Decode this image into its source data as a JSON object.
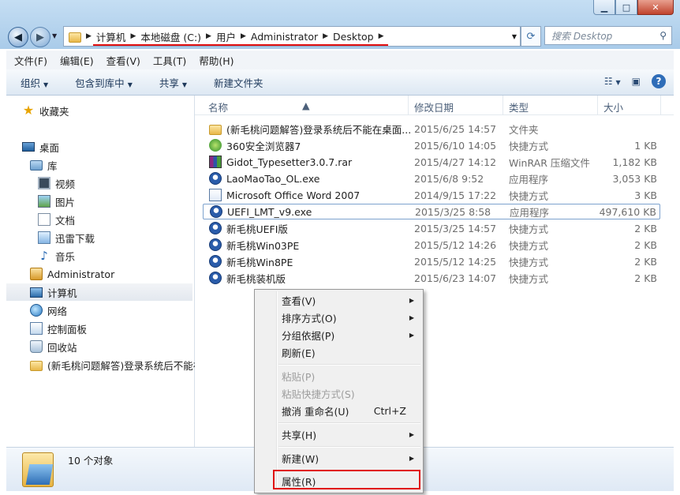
{
  "window": {
    "min_glyph": "▁",
    "max_glyph": "□",
    "close_glyph": "✕"
  },
  "address": {
    "segments": [
      "计算机",
      "本地磁盘 (C:)",
      "用户",
      "Administrator",
      "Desktop"
    ]
  },
  "search": {
    "placeholder": "搜索 Desktop"
  },
  "menu": [
    "文件(F)",
    "编辑(E)",
    "查看(V)",
    "工具(T)",
    "帮助(H)"
  ],
  "toolbar": {
    "organize": "组织",
    "include_library": "包含到库中",
    "share": "共享",
    "new_folder": "新建文件夹"
  },
  "sidebar": {
    "favorites": "收藏夹",
    "desktop": "桌面",
    "library": "库",
    "video": "视频",
    "pictures": "图片",
    "documents": "文档",
    "xunlei": "迅雷下载",
    "music": "音乐",
    "administrator": "Administrator",
    "computer": "计算机",
    "network": "网络",
    "control_panel": "控制面板",
    "recycle_bin": "回收站",
    "folder": "(新毛桃问题解答)登录系统后不能在"
  },
  "columns": {
    "name": "名称",
    "modified": "修改日期",
    "type": "类型",
    "size": "大小"
  },
  "files": [
    {
      "name": "(新毛桃问题解答)登录系统后不能在桌面...",
      "date": "2015/6/25 14:57",
      "type": "文件夹",
      "size": "",
      "icon": "folder-icon"
    },
    {
      "name": "360安全浏览器7",
      "date": "2015/6/10 14:05",
      "type": "快捷方式",
      "size": "1 KB",
      "icon": "browser-shortcut-icon"
    },
    {
      "name": "Gidot_Typesetter3.0.7.rar",
      "date": "2015/4/27 14:12",
      "type": "WinRAR 压缩文件",
      "size": "1,182 KB",
      "icon": "winrar-icon"
    },
    {
      "name": "LaoMaoTao_OL.exe",
      "date": "2015/6/8 9:52",
      "type": "应用程序",
      "size": "3,053 KB",
      "icon": "laomaotao-icon"
    },
    {
      "name": "Microsoft Office Word 2007",
      "date": "2014/9/15 17:22",
      "type": "快捷方式",
      "size": "3 KB",
      "icon": "word-shortcut-icon"
    },
    {
      "name": "UEFI_LMT_v9.exe",
      "date": "2015/3/25 8:58",
      "type": "应用程序",
      "size": "497,610 KB",
      "icon": "laomaotao-icon"
    },
    {
      "name": "新毛桃UEFI版",
      "date": "2015/3/25 14:57",
      "type": "快捷方式",
      "size": "2 KB",
      "icon": "laomaotao-icon"
    },
    {
      "name": "新毛桃Win03PE",
      "date": "2015/5/12 14:26",
      "type": "快捷方式",
      "size": "2 KB",
      "icon": "laomaotao-icon"
    },
    {
      "name": "新毛桃Win8PE",
      "date": "2015/5/12 14:25",
      "type": "快捷方式",
      "size": "2 KB",
      "icon": "laomaotao-icon"
    },
    {
      "name": "新毛桃装机版",
      "date": "2015/6/23 14:07",
      "type": "快捷方式",
      "size": "2 KB",
      "icon": "laomaotao-icon"
    }
  ],
  "status": {
    "count": "10 个对象"
  },
  "context_menu": {
    "view": "查看(V)",
    "sort": "排序方式(O)",
    "group": "分组依据(P)",
    "refresh": "刷新(E)",
    "paste": "粘贴(P)",
    "paste_shortcut": "粘贴快捷方式(S)",
    "undo": "撤消 重命名(U)",
    "undo_shortcut": "Ctrl+Z",
    "share": "共享(H)",
    "new": "新建(W)",
    "properties": "属性(R)"
  },
  "annotation_color": "#e01010"
}
